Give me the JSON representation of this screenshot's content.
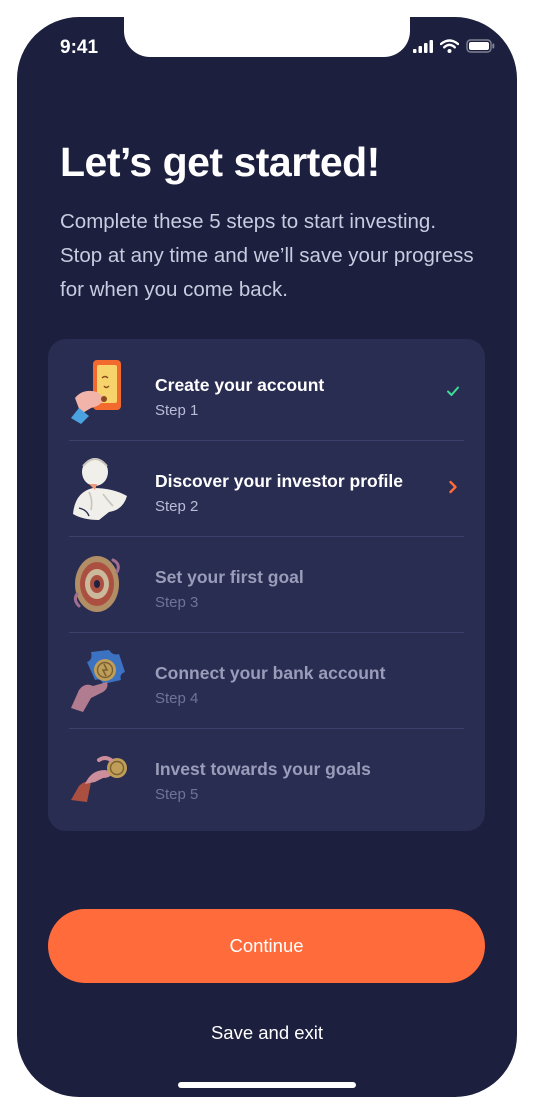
{
  "status_bar": {
    "time": "9:41",
    "icons": [
      "cellular-signal-icon",
      "wifi-icon",
      "battery-icon"
    ]
  },
  "header": {
    "title": "Let’s get started!",
    "subtitle": "Complete these 5 steps to start investing. Stop at any time and we’ll save your progress for when you come back."
  },
  "steps": [
    {
      "title": "Create your account",
      "subtitle": "Step 1",
      "state": "completed",
      "icon": "phone-in-hand-icon"
    },
    {
      "title": "Discover your investor profile",
      "subtitle": "Step 2",
      "state": "current",
      "icon": "statue-bust-icon"
    },
    {
      "title": "Set your first goal",
      "subtitle": "Step 3",
      "state": "locked",
      "icon": "target-icon"
    },
    {
      "title": "Connect your bank account",
      "subtitle": "Step 4",
      "state": "locked",
      "icon": "puzzle-coin-hand-icon"
    },
    {
      "title": "Invest towards your goals",
      "subtitle": "Step 5",
      "state": "locked",
      "icon": "coin-in-hand-icon"
    }
  ],
  "actions": {
    "continue_label": "Continue",
    "save_exit_label": "Save and exit"
  },
  "colors": {
    "background": "#1c1f3d",
    "card": "#2a2d52",
    "accent": "#ff6b3a",
    "check": "#3ddc97"
  }
}
